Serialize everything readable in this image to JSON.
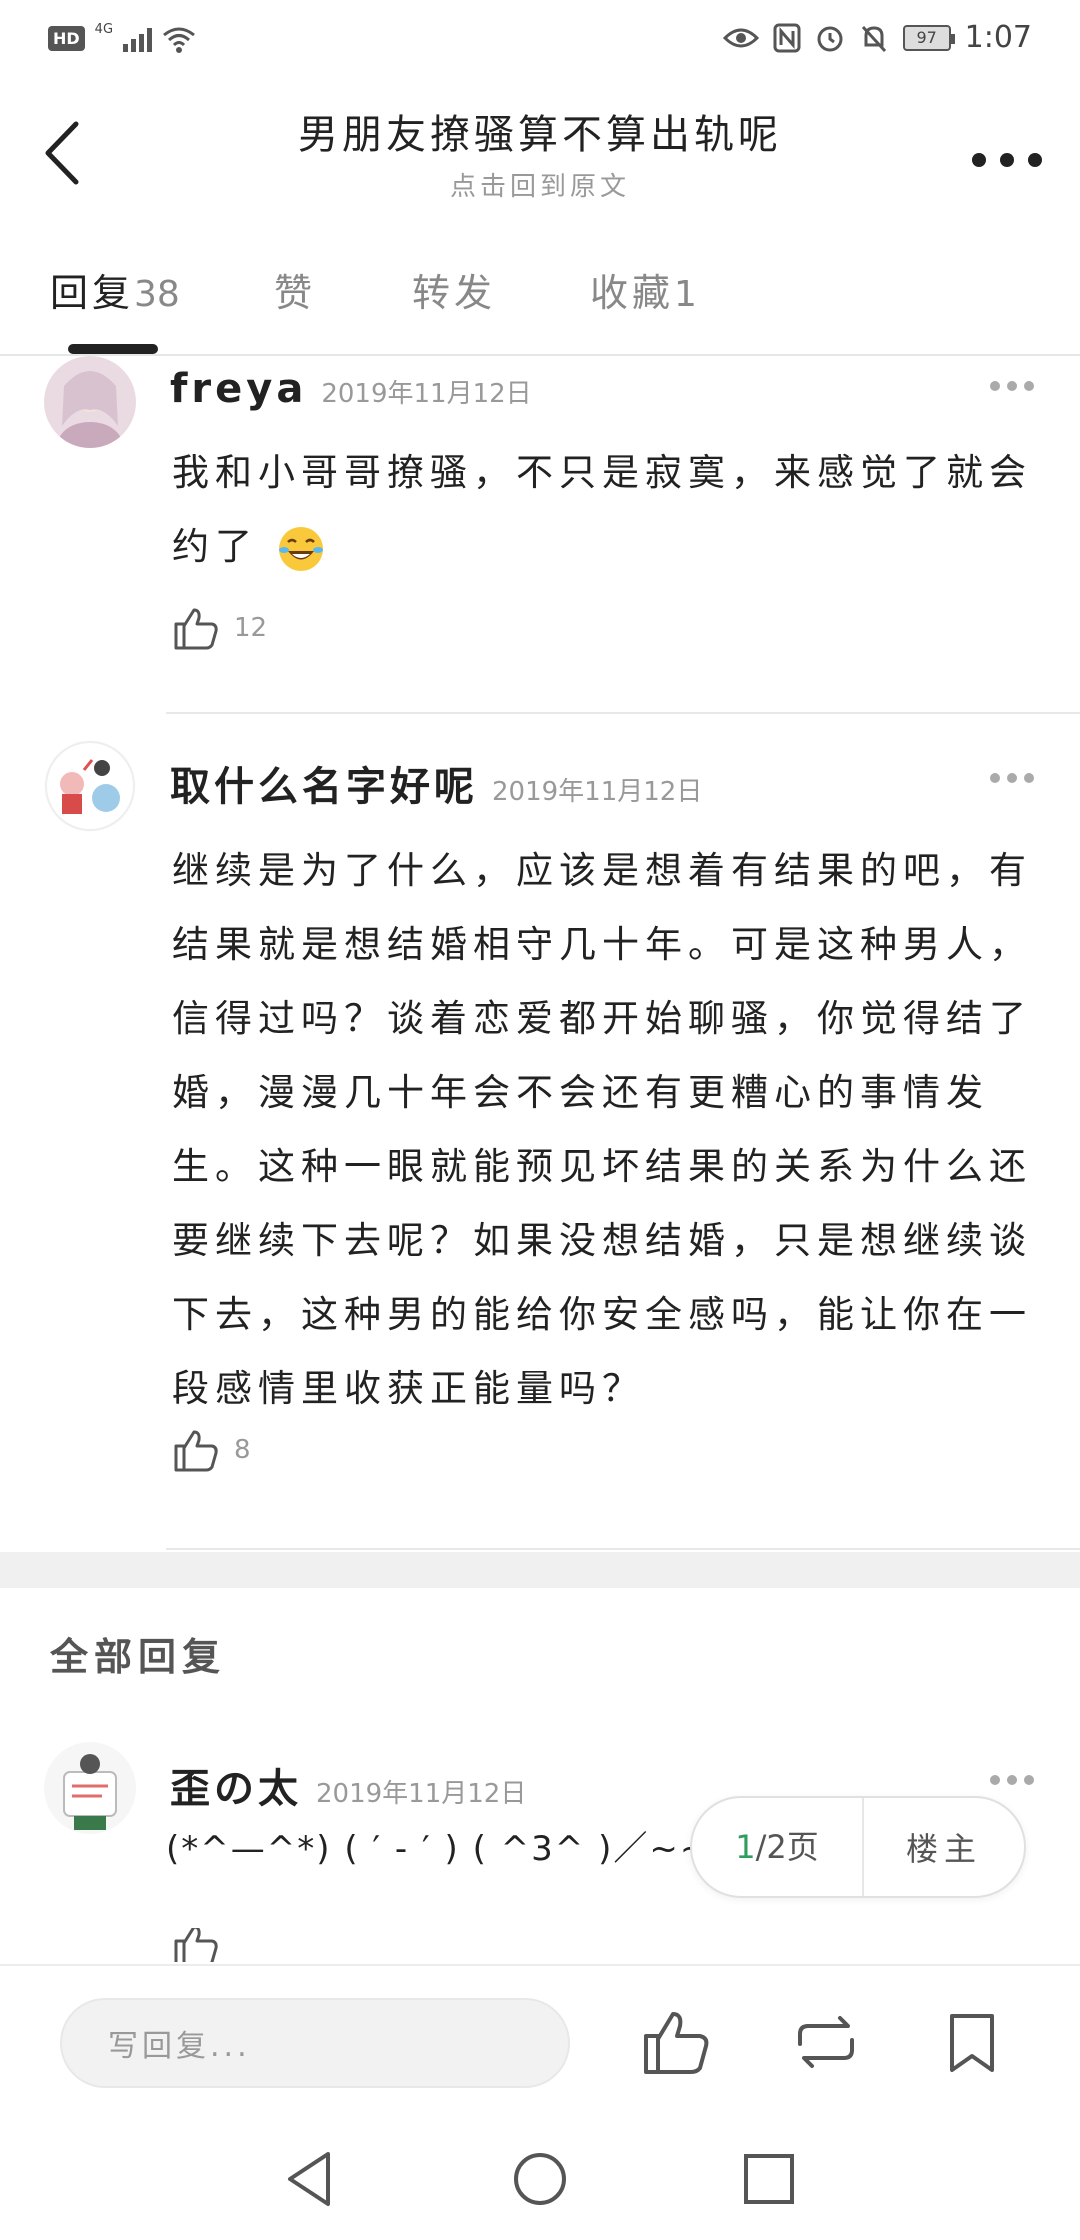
{
  "status_bar": {
    "hd": "HD",
    "network": "4G",
    "battery": "97",
    "time": "1:07"
  },
  "header": {
    "title": "男朋友撩骚算不算出轨呢",
    "subtitle": "点击回到原文"
  },
  "tabs": [
    {
      "label": "回复",
      "count": "38"
    },
    {
      "label": "赞",
      "count": ""
    },
    {
      "label": "转发",
      "count": ""
    },
    {
      "label": "收藏",
      "count": "1"
    }
  ],
  "hot_comments": [
    {
      "name": "freya",
      "date": "2019年11月12日",
      "text": "我和小哥哥撩骚，不只是寂寞，来感觉了就会约了",
      "likes": "12"
    },
    {
      "name": "取什么名字好呢",
      "date": "2019年11月12日",
      "text": "继续是为了什么，应该是想着有结果的吧，有结果就是想结婚相守几十年。可是这种男人，信得过吗？谈着恋爱都开始聊骚，你觉得结了婚，漫漫几十年会不会还有更糟心的事情发生。这种一眼就能预见坏结果的关系为什么还要继续下去呢？如果没想结婚，只是想继续谈下去，这种男的能给你安全感吗，能让你在一段感情里收获正能量吗？",
      "likes": "8"
    }
  ],
  "all_replies": {
    "title": "全部回复",
    "items": [
      {
        "name": "歪の太",
        "date": "2019年11月12日",
        "text": "(*^—^*) ( ′ - ′ ) ( ^3^ )／~~"
      }
    ]
  },
  "pager": {
    "current": "1",
    "total_text": "/2页",
    "owner_label": "楼主"
  },
  "toolbar": {
    "reply_placeholder": "写回复..."
  },
  "colors": {
    "accent_green": "#2e9e5e",
    "text_dark": "#222222",
    "text_muted": "#999999"
  }
}
